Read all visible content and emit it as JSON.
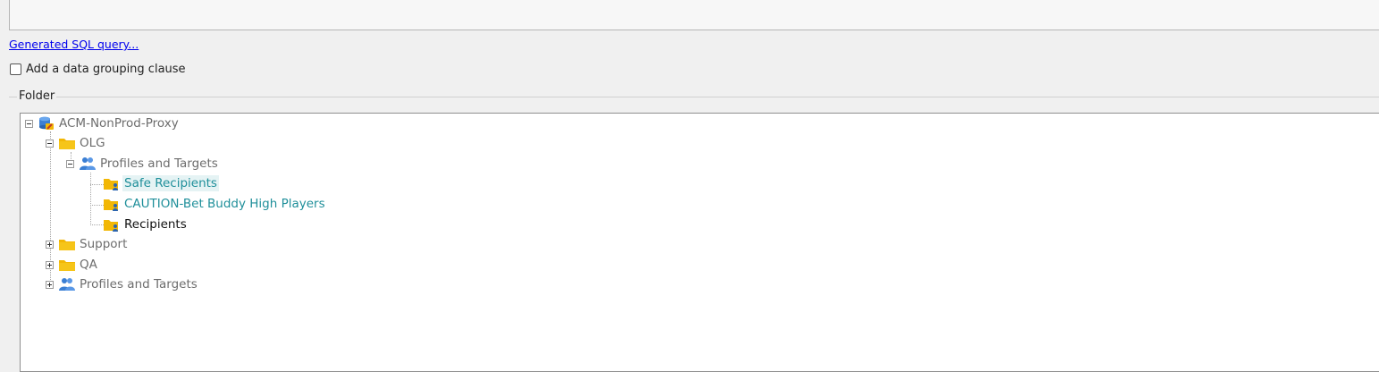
{
  "links": {
    "generated_sql": "Generated SQL query..."
  },
  "grouping": {
    "label": "Add a data grouping clause",
    "checked": false
  },
  "folder": {
    "label": "Folder"
  },
  "tree": {
    "root": "ACM-NonProd-Proxy",
    "olg": "OLG",
    "profiles_targets_1": "Profiles and Targets",
    "safe_recipients": "Safe Recipients",
    "caution_bet_buddy": "CAUTION-Bet Buddy High Players",
    "recipients": "Recipients",
    "support": "Support",
    "qa": "QA",
    "profiles_targets_2": "Profiles and Targets"
  },
  "icons": {
    "root": "database-icon",
    "folder": "folder-icon",
    "group": "user-group-icon",
    "recipient_folder": "recipient-folder-icon"
  },
  "colors": {
    "link": "#0000ee",
    "teal_text": "#1f8f9a",
    "gray_text": "#6d6d6d",
    "folder": "#f2b705"
  }
}
